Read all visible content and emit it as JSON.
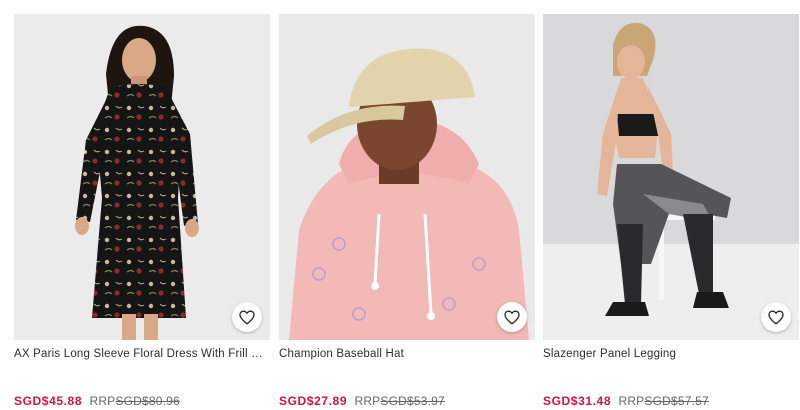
{
  "products": [
    {
      "name": "AX Paris Long Sleeve Floral Dress With Frill Detail",
      "price": "SGD$45.88",
      "rrp_label": "RRP",
      "was_price": "SGD$80.96",
      "image_subject": "floral-dress-photo"
    },
    {
      "name": "Champion Baseball Hat",
      "price": "SGD$27.89",
      "rrp_label": "RRP",
      "was_price": "SGD$53.97",
      "image_subject": "baseball-hat-photo"
    },
    {
      "name": "Slazenger Panel Legging",
      "price": "SGD$31.48",
      "rrp_label": "RRP",
      "was_price": "SGD$57.57",
      "image_subject": "panel-legging-photo"
    }
  ],
  "colors": {
    "sale_price": "#d01345",
    "strikethrough": "#666666",
    "title_text": "#2d2d2d"
  },
  "icons": {
    "save": "heart-icon"
  }
}
